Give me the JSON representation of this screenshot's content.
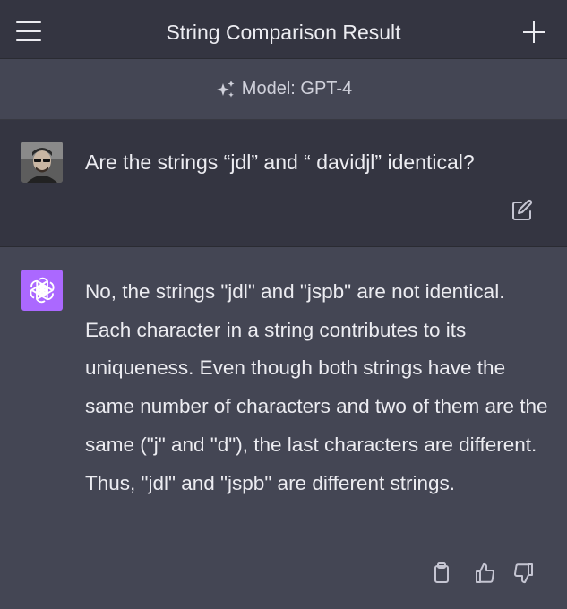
{
  "header": {
    "title": "String Comparison Result",
    "menu_icon": "hamburger-menu-icon",
    "new_chat_icon": "plus-icon"
  },
  "model": {
    "label": "Model: GPT-4",
    "icon": "sparkle-icon"
  },
  "user_message": {
    "text": "Are the strings “jdl” and “ davidjl” identical?",
    "avatar": "user-avatar-photo",
    "edit_icon": "edit-icon"
  },
  "assistant_message": {
    "text": "No, the strings \"jdl\" and \"jspb\" are not identical. Each character in a string contributes to its uniqueness. Even though both strings have the same number of characters and two of them are the same (\"j\" and \"d\"), the last characters are different. Thus, \"jdl\" and \"jspb\" are different strings.",
    "avatar": "openai-logo-icon",
    "actions": [
      "clipboard-icon",
      "thumbs-up-icon",
      "thumbs-down-icon"
    ]
  },
  "colors": {
    "header_bg": "#343541",
    "assistant_bg": "#444654",
    "assistant_avatar": "#ab68ff",
    "text": "#ececf1"
  }
}
